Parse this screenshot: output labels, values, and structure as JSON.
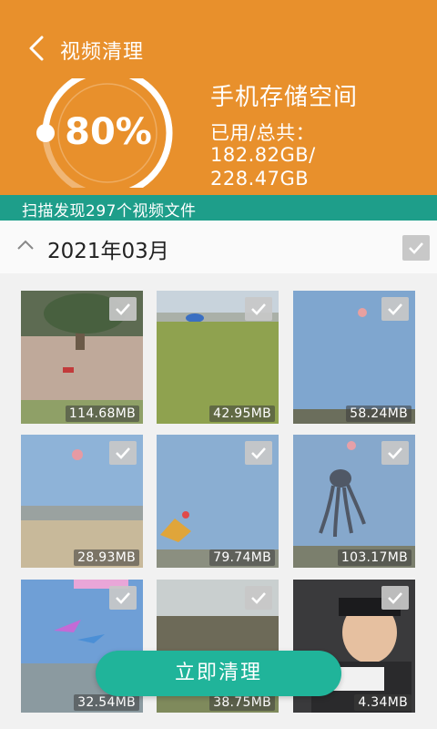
{
  "header": {
    "title": "视频清理",
    "storage_percent": 80,
    "storage_percent_label": "80%",
    "storage_title": "手机存储空间",
    "used_total_label": "已用/总共：",
    "used_value": "182.82GB/",
    "total_value": "228.47GB"
  },
  "banner": {
    "text": "扫描发现297个视频文件"
  },
  "group": {
    "title": "2021年03月",
    "checked": true
  },
  "videos": [
    {
      "size": "114.68MB",
      "checked": true
    },
    {
      "size": "42.95MB",
      "checked": true
    },
    {
      "size": "58.24MB",
      "checked": true
    },
    {
      "size": "28.93MB",
      "checked": true
    },
    {
      "size": "79.74MB",
      "checked": true
    },
    {
      "size": "103.17MB",
      "checked": true
    },
    {
      "size": "32.54MB",
      "checked": true
    },
    {
      "size": "38.75MB",
      "checked": true
    },
    {
      "size": "4.34MB",
      "checked": true
    }
  ],
  "action": {
    "clean_label": "立即清理"
  },
  "colors": {
    "header_bg": "#e8902c",
    "banner_bg": "#1e9e8a",
    "button_bg": "#20b49a"
  }
}
